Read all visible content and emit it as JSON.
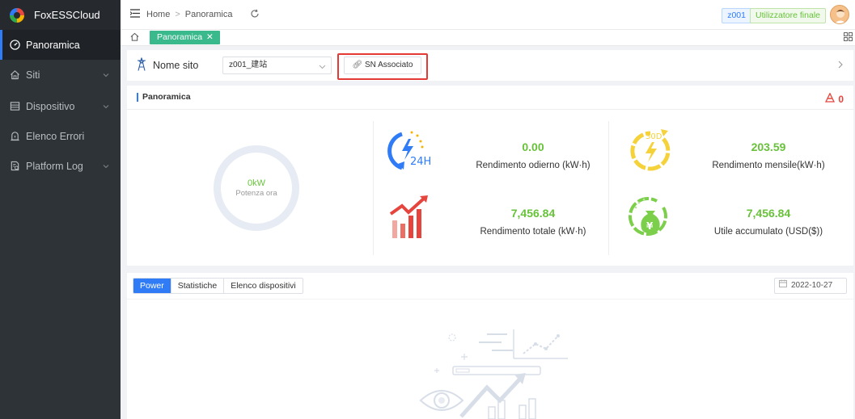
{
  "app": {
    "name": "FoxESSCloud"
  },
  "sidebar": {
    "items": [
      {
        "label": "Panoramica",
        "icon": "dashboard-gauge-icon",
        "active": true,
        "has_children": false
      },
      {
        "label": "Siti",
        "icon": "home-icon",
        "active": false,
        "has_children": true
      },
      {
        "label": "Dispositivo",
        "icon": "device-list-icon",
        "active": false,
        "has_children": true
      },
      {
        "label": "Elenco Errori",
        "icon": "error-alert-icon",
        "active": false,
        "has_children": false
      },
      {
        "label": "Platform Log",
        "icon": "log-document-icon",
        "active": false,
        "has_children": true
      }
    ]
  },
  "header": {
    "breadcrumb": [
      "Home",
      "Panoramica"
    ],
    "user": "z001",
    "role": "Utilizzatore finale"
  },
  "tabs": [
    {
      "label": "Panoramica",
      "closable": true
    }
  ],
  "site": {
    "label": "Nome sito",
    "selected": "z001_建站",
    "sn_button": "SN Associato"
  },
  "overview": {
    "title": "Panoramica",
    "alarm_count": "0",
    "current_power": {
      "value": "0kW",
      "label": "Potenza ora"
    },
    "metrics": [
      {
        "value": "0.00",
        "label": "Rendimento odierno (kW·h)",
        "icon": "24h-energy-icon"
      },
      {
        "value": "203.59",
        "label": "Rendimento mensile(kW·h)",
        "icon": "30d-energy-icon"
      },
      {
        "value": "7,456.84",
        "label": "Rendimento totale (kW·h)",
        "icon": "rising-chart-icon"
      },
      {
        "value": "7,456.84",
        "label": "Utile accumulato (USD($))",
        "icon": "money-bag-icon"
      }
    ]
  },
  "bottom": {
    "tabs": [
      {
        "label": "Power",
        "active": true
      },
      {
        "label": "Statistiche",
        "active": false
      },
      {
        "label": "Elenco dispositivi",
        "active": false
      }
    ],
    "date": "2022-10-27"
  },
  "colors": {
    "sidebar_bg": "#2e3338",
    "accent_blue": "#2f7cf6",
    "value_green": "#67c23a",
    "tab_green": "#3ab98c",
    "alert_red": "#e5453d"
  }
}
